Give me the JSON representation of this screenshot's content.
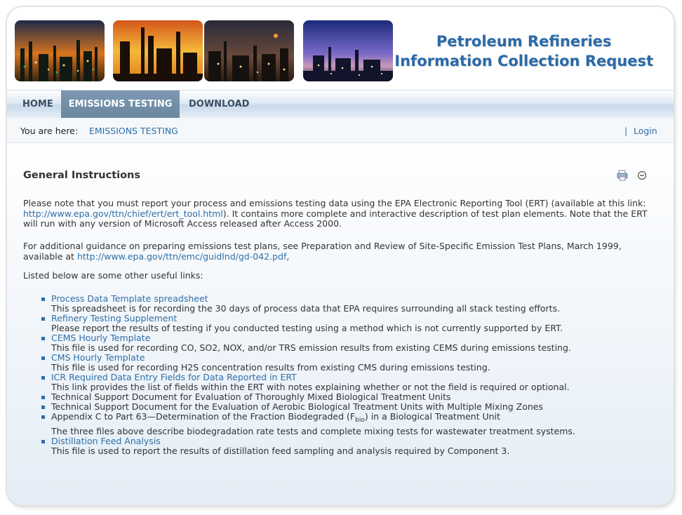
{
  "header": {
    "title_line1": "Petroleum Refineries",
    "title_line2": "Information Collection Request"
  },
  "nav": {
    "home": "HOME",
    "emissions_testing": "EMISSIONS TESTING",
    "download": "DOWNLOAD"
  },
  "breadcrumb": {
    "prefix": "You are here:",
    "current": "EMISSIONS TESTING",
    "separator": "|",
    "login": "Login"
  },
  "section": {
    "title": "General Instructions",
    "tool_icons": [
      "print-icon",
      "collapse-icon"
    ]
  },
  "paragraphs": {
    "p1_before": "Please note that you must report your process and emissions testing data using the EPA Electronic Reporting Tool (ERT) (available at this link: ",
    "p1_link": "http://www.epa.gov/ttn/chief/ert/ert_tool.html",
    "p1_after": ").  It contains more complete and interactive description of test plan elements.  Note that the ERT will run with any version of Microsoft Access released after Access 2000.",
    "p2_before": "For additional guidance on preparing emissions test plans, see Preparation and Review of Site-Specific Emission Test Plans, March 1999, available at ",
    "p2_link": "http://www.epa.gov/ttn/emc/guidlnd/gd-042.pdf",
    "p2_after": ",",
    "p3": "Listed below are some other useful links:"
  },
  "links": [
    {
      "label": "Process Data Template spreadsheet",
      "desc": "This spreadsheet is for recording the 30 days of process data that EPA requires surrounding all stack testing efforts."
    },
    {
      "label": "Refinery Testing Supplement",
      "desc": "Please report the results of testing if you conducted testing using a method which is not currently supported by ERT."
    },
    {
      "label": "CEMS Hourly Template",
      "desc": "This file is used for recording CO, SO2, NOX, and/or TRS emission results from existing CEMS during emissions testing."
    },
    {
      "label": "CMS Hourly Template",
      "desc": "This file is used for recording H2S concentration results from existing CMS during emissions testing."
    },
    {
      "label": "ICR Required Data Entry Fields for Data Reported in ERT",
      "desc": "This link provides the list of fields within the ERT with notes explaining whether or not the field is required or optional."
    }
  ],
  "plain_items": {
    "item1": "Technical Support Document for Evaluation of Thoroughly Mixed Biological Treatment Units",
    "item2": "Technical Support Document for the Evaluation of Aerobic Biological Treatment Units with Multiple Mixing Zones",
    "item3_before": "Appendix C to Part 63—Determination of the Fraction Biodegraded (F",
    "item3_sub": "bio",
    "item3_after": ") in a Biological Treatment Unit",
    "item3_desc": "The three files above describe biodegradation rate tests and complete mixing tests for wastewater treatment systems."
  },
  "last_link": {
    "label": "Distillation Feed Analysis",
    "desc": "This file is used to report the results of distillation feed sampling and analysis required by Component 3."
  },
  "colors": {
    "link": "#2e6fa7",
    "title": "#2a6aa8",
    "nav_active": "#7391ab"
  }
}
